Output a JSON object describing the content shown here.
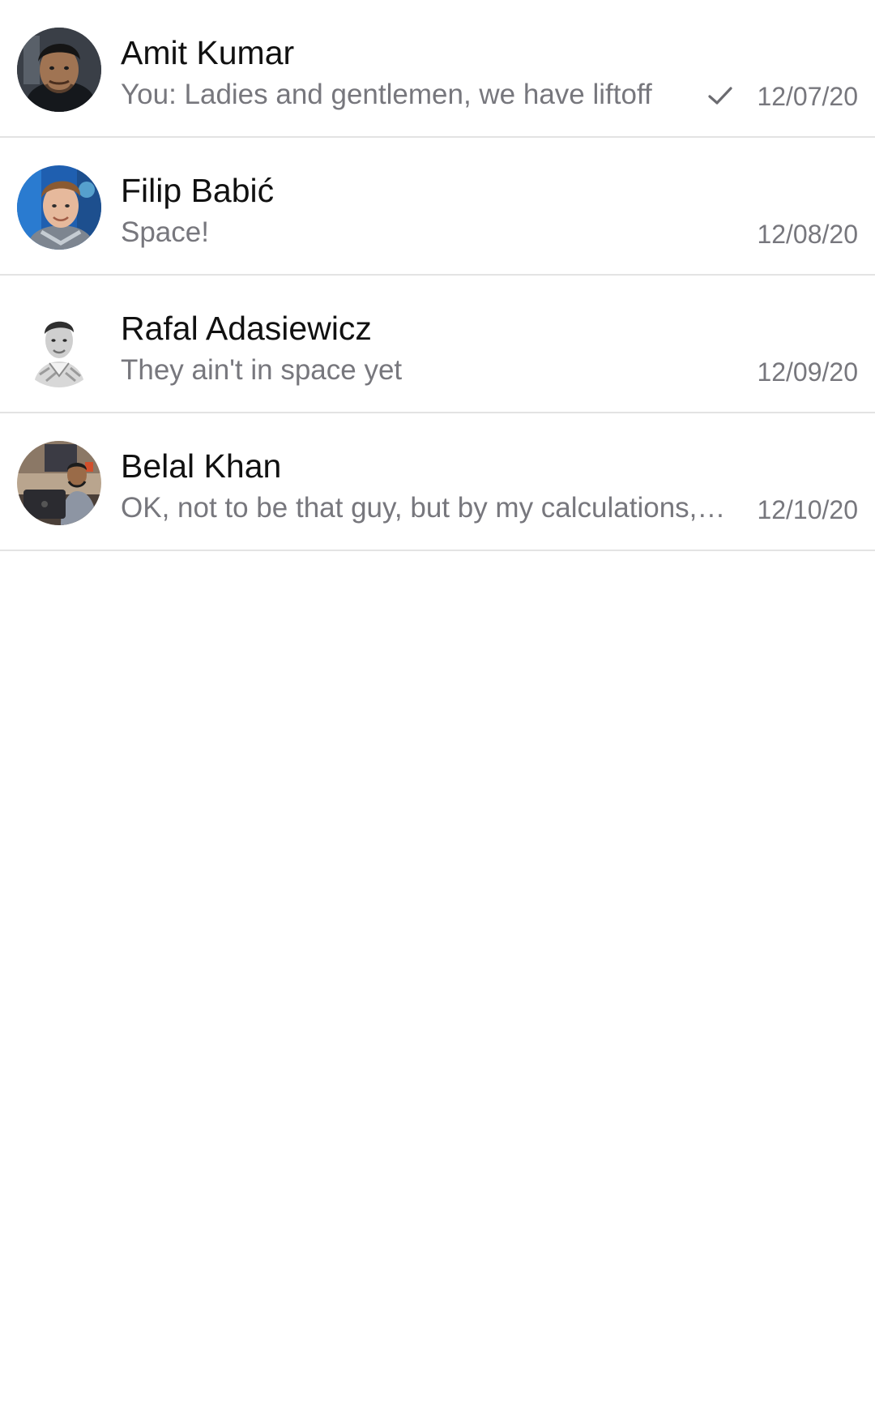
{
  "conversations": [
    {
      "name": "Amit Kumar",
      "preview": "You: Ladies and gentlemen, we have liftoff",
      "date": "12/07/20",
      "sent_check": true,
      "avatar_icon": "person-avatar"
    },
    {
      "name": "Filip Babić",
      "preview": "Space!",
      "date": "12/08/20",
      "sent_check": false,
      "avatar_icon": "person-avatar"
    },
    {
      "name": "Rafal Adasiewicz",
      "preview": "They ain't in space yet",
      "date": "12/09/20",
      "sent_check": false,
      "avatar_icon": "person-avatar"
    },
    {
      "name": "Belal Khan",
      "preview": "OK, not to be that guy, but by my calculations, we still have a long way to go",
      "date": "12/10/20",
      "sent_check": false,
      "avatar_icon": "person-avatar"
    }
  ],
  "colors": {
    "name_text": "#111111",
    "secondary_text": "#77777d",
    "divider": "#e3e3e3",
    "background": "#ffffff"
  }
}
